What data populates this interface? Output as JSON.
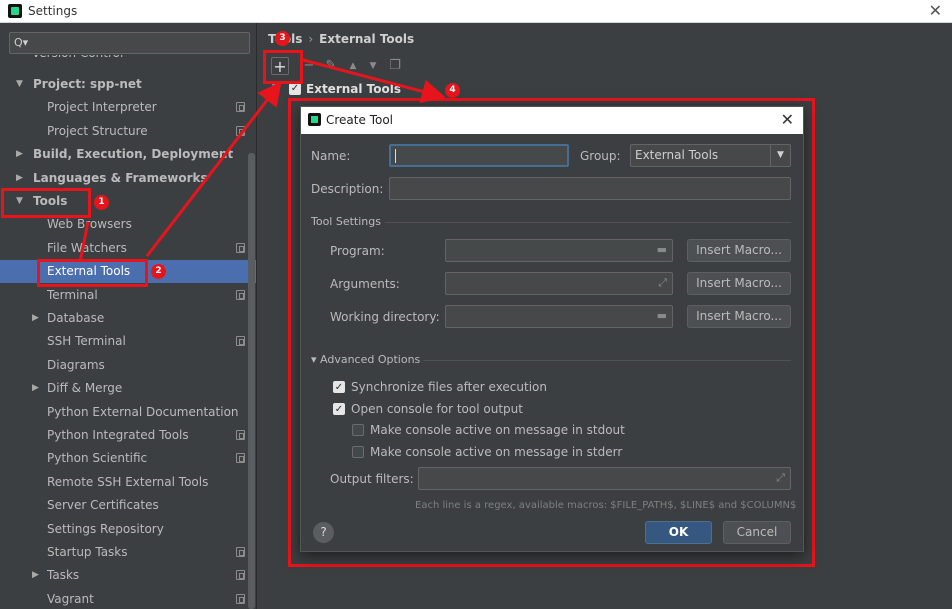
{
  "window": {
    "title": "Settings"
  },
  "sidebar": {
    "search_placeholder": "Q▾",
    "partial_top": "Version Control",
    "items": [
      {
        "label": "Project: spp-net",
        "bold": true,
        "expanded": true
      },
      {
        "label": "Project Interpreter"
      },
      {
        "label": "Project Structure"
      },
      {
        "label": "Build, Execution, Deployment",
        "bold": true
      },
      {
        "label": "Languages & Frameworks",
        "bold": true
      },
      {
        "label": "Tools",
        "bold": true,
        "expanded": true
      },
      {
        "label": "Web Browsers"
      },
      {
        "label": "File Watchers"
      },
      {
        "label": "External Tools",
        "selected": true
      },
      {
        "label": "Terminal"
      },
      {
        "label": "Database"
      },
      {
        "label": "SSH Terminal"
      },
      {
        "label": "Diagrams"
      },
      {
        "label": "Diff & Merge"
      },
      {
        "label": "Python External Documentation"
      },
      {
        "label": "Python Integrated Tools"
      },
      {
        "label": "Python Scientific"
      },
      {
        "label": "Remote SSH External Tools"
      },
      {
        "label": "Server Certificates"
      },
      {
        "label": "Settings Repository"
      },
      {
        "label": "Startup Tasks"
      },
      {
        "label": "Tasks"
      },
      {
        "label": "Vagrant"
      }
    ]
  },
  "breadcrumb": {
    "parent": "Tools",
    "sep": "›",
    "current": "External Tools"
  },
  "toolbar": {
    "add_icon": "+",
    "remove_icon": "−",
    "edit_icon": "✎",
    "up_icon": "▲",
    "down_icon": "▼",
    "copy_icon": "❐"
  },
  "tree": {
    "root_label": "External Tools",
    "checked": true
  },
  "annotations": {
    "badge1": "1",
    "badge2": "2",
    "badge3": "3",
    "badge4": "4",
    "color": "#e8141c"
  },
  "dialog": {
    "title": "Create Tool",
    "close": "✕",
    "name_label": "Name:",
    "name_value": "",
    "group_label": "Group:",
    "group_value": "External Tools",
    "description_label": "Description:",
    "tool_settings_label": "Tool Settings",
    "program_label": "Program:",
    "arguments_label": "Arguments:",
    "workdir_label": "Working directory:",
    "insert_macro": "Insert Macro...",
    "advanced_label": "▾ Advanced Options",
    "sync_label": "Synchronize files after execution",
    "sync_checked": true,
    "console_label": "Open console for tool output",
    "console_checked": true,
    "stdout_label": "Make console active on message in stdout",
    "stdout_checked": false,
    "stderr_label": "Make console active on message in stderr",
    "stderr_checked": false,
    "output_filters_label": "Output filters:",
    "hint": "Each line is a regex, available macros: $FILE_PATH$, $LINE$ and $COLUMN$",
    "help": "?",
    "ok": "OK",
    "cancel": "Cancel"
  }
}
